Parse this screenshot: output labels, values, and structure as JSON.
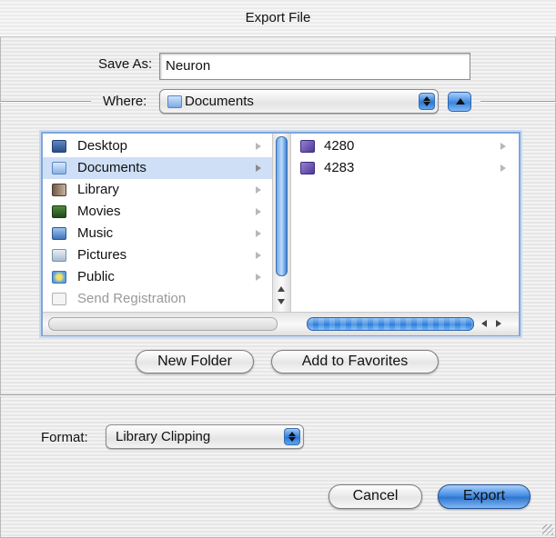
{
  "window": {
    "title": "Export File"
  },
  "save_as": {
    "label": "Save As:",
    "value": "Neuron"
  },
  "where": {
    "label": "Where:",
    "value": "Documents"
  },
  "sidebar": {
    "items": [
      {
        "label": "Desktop",
        "icon": "desktop-icon",
        "selected": false,
        "enabled": true
      },
      {
        "label": "Documents",
        "icon": "documents-folder-icon",
        "selected": true,
        "enabled": true
      },
      {
        "label": "Library",
        "icon": "library-folder-icon",
        "selected": false,
        "enabled": true
      },
      {
        "label": "Movies",
        "icon": "movies-folder-icon",
        "selected": false,
        "enabled": true
      },
      {
        "label": "Music",
        "icon": "music-folder-icon",
        "selected": false,
        "enabled": true
      },
      {
        "label": "Pictures",
        "icon": "pictures-folder-icon",
        "selected": false,
        "enabled": true
      },
      {
        "label": "Public",
        "icon": "public-folder-icon",
        "selected": false,
        "enabled": true
      },
      {
        "label": "Send Registration",
        "icon": "alias-icon",
        "selected": false,
        "enabled": false
      }
    ]
  },
  "contents": {
    "items": [
      {
        "label": "4280",
        "icon": "folder-icon"
      },
      {
        "label": "4283",
        "icon": "folder-icon"
      }
    ]
  },
  "buttons": {
    "new_folder": "New Folder",
    "add_to_favorites": "Add to Favorites",
    "cancel": "Cancel",
    "export": "Export"
  },
  "format": {
    "label": "Format:",
    "value": "Library Clipping"
  },
  "colors": {
    "accent": "#2f73cc",
    "selection": "#cfdff6"
  }
}
